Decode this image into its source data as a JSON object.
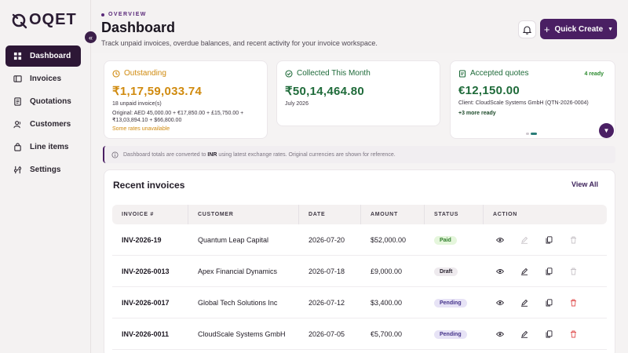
{
  "brand": {
    "name": "OQET"
  },
  "sidebar": {
    "items": [
      {
        "label": "Dashboard",
        "icon": "grid-icon",
        "active": true
      },
      {
        "label": "Invoices",
        "icon": "invoice-icon"
      },
      {
        "label": "Quotations",
        "icon": "quotation-icon"
      },
      {
        "label": "Customers",
        "icon": "users-icon"
      },
      {
        "label": "Line items",
        "icon": "bag-icon"
      },
      {
        "label": "Settings",
        "icon": "sliders-icon"
      }
    ]
  },
  "header": {
    "eyebrow": "OVERVIEW",
    "title": "Dashboard",
    "subtitle": "Track unpaid invoices, overdue balances, and recent activity for your invoice workspace.",
    "quick_create": "Quick Create"
  },
  "cards": {
    "outstanding": {
      "label": "Outstanding",
      "value": "₹1,17,59,033.74",
      "count": "18 unpaid invoice(s)",
      "original": "Original: AED 45,000.00 + €17,850.00 + £15,750.00 + ₹13,03,894.10 + $66,800.00",
      "warning": "Some rates unavailable"
    },
    "collected": {
      "label": "Collected This Month",
      "value": "₹50,14,464.80",
      "period": "July 2026"
    },
    "accepted": {
      "label": "Accepted quotes",
      "badge": "4 ready",
      "value": "€12,150.00",
      "client": "Client: CloudScale Systems GmbH (QTN-2026-0004)",
      "more": "+3 more ready"
    }
  },
  "notice": {
    "prefix": "Dashboard totals are converted to",
    "currency": "INR",
    "suffix": "using latest exchange rates. Original currencies are shown for reference."
  },
  "invoices": {
    "title": "Recent invoices",
    "view_all": "View All",
    "columns": [
      "INVOICE #",
      "CUSTOMER",
      "DATE",
      "AMOUNT",
      "STATUS",
      "ACTION"
    ],
    "rows": [
      {
        "number": "INV-2026-19",
        "customer": "Quantum Leap Capital",
        "date": "2026-07-20",
        "amount": "$52,000.00",
        "status": "Paid"
      },
      {
        "number": "INV-2026-0013",
        "customer": "Apex Financial Dynamics",
        "date": "2026-07-18",
        "amount": "£9,000.00",
        "status": "Draft"
      },
      {
        "number": "INV-2026-0017",
        "customer": "Global Tech Solutions Inc",
        "date": "2026-07-12",
        "amount": "$3,400.00",
        "status": "Pending"
      },
      {
        "number": "INV-2026-0011",
        "customer": "CloudScale Systems GmbH",
        "date": "2026-07-05",
        "amount": "€5,700.00",
        "status": "Pending"
      }
    ]
  },
  "colors": {
    "accent": "#4a1f63",
    "nav_active": "#2d1736",
    "outstanding": "#d08a0e",
    "collected": "#1f6b3a",
    "accepted": "#1f6b3a",
    "danger": "#e05252"
  }
}
